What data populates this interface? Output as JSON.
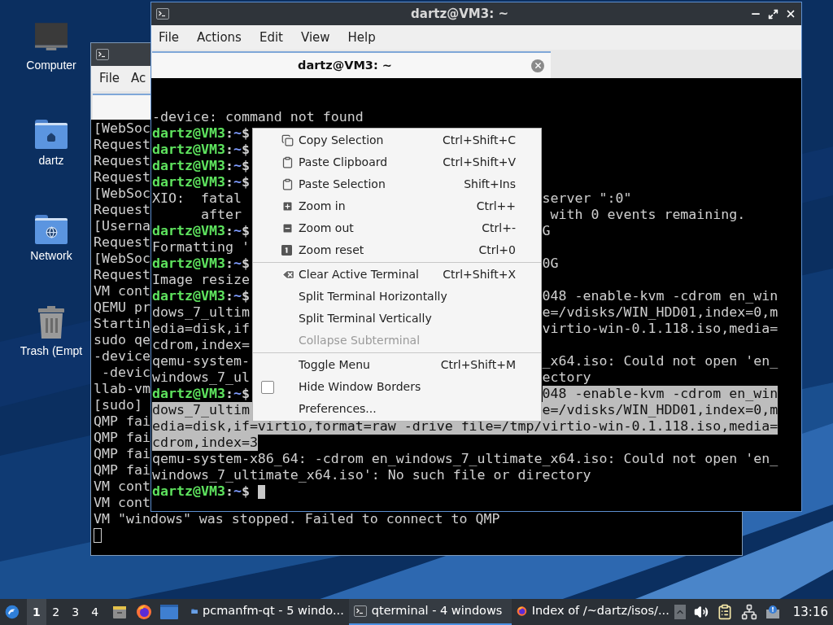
{
  "desktop": {
    "icons": [
      {
        "label": "Computer",
        "kind": "computer"
      },
      {
        "label": "dartz",
        "kind": "home"
      },
      {
        "label": "Network",
        "kind": "network"
      },
      {
        "label": "Trash (Empt",
        "kind": "trash"
      }
    ]
  },
  "back_window": {
    "menu": [
      "File",
      "Ac"
    ],
    "lines": [
      "[WebSoc",
      "Request",
      "Request",
      "Request",
      "[WebSoc",
      "Request",
      "[Userna",
      "Request",
      "[WebSoc",
      "Request",
      "VM cont",
      "QEMU pr",
      "Startin",
      "sudo qe",
      "-device",
      " -devic",
      "llab-vm",
      "[sudo] ",
      "QMP fai",
      "QMP fai",
      "QMP fai",
      "QMP fai",
      "VM cont",
      "VM cont",
      "VM \"windows\" was stopped. Failed to connect to QMP"
    ]
  },
  "front_window": {
    "title": "dartz@VM3: ~",
    "menu": [
      "File",
      "Actions",
      "Edit",
      "View",
      "Help"
    ],
    "tabs": [
      {
        "label": "dartz@VM3: ~",
        "selected": true
      }
    ],
    "lines": [
      {
        "text": "-device: command not found",
        "selected": false
      },
      {
        "prompt": {
          "user": "dartz@VM3",
          "colon": ":",
          "path": "~",
          "sign": "$"
        },
        "selected": false
      },
      {
        "prompt": {
          "user": "dartz@VM3",
          "colon": ":",
          "path": "~",
          "sign": "$"
        },
        "selected": false
      },
      {
        "prompt": {
          "user": "dartz@VM3",
          "colon": ":",
          "path": "~",
          "sign": "$"
        },
        "selected": false
      },
      {
        "prompt": {
          "user": "dartz@VM3",
          "colon": ":",
          "path": "~",
          "sign": "$"
        },
        "selected": false
      },
      {
        "text": "XIO:  fatal",
        "right": "server \":0\"",
        "selected": false
      },
      {
        "text": "      after",
        "right": " with 0 events remaining.",
        "selected": false
      },
      {
        "prompt": {
          "user": "dartz@VM3",
          "colon": ":",
          "path": "~",
          "sign": "$"
        },
        "right": "G",
        "selected": false
      },
      {
        "text": "Formatting '",
        "selected": false
      },
      {
        "prompt": {
          "user": "dartz@VM3",
          "colon": ":",
          "path": "~",
          "sign": "$"
        },
        "right": "0G",
        "selected": false
      },
      {
        "text": "Image resize",
        "selected": false
      },
      {
        "prompt": {
          "user": "dartz@VM3",
          "colon": ":",
          "path": "~",
          "sign": "$"
        },
        "right": "048 -enable-kvm -cdrom en_win",
        "selected": false
      },
      {
        "text": "dows_7_ultim",
        "right": "e=/vdisks/WIN_HDD01,index=0,m",
        "selected": false
      },
      {
        "text": "edia=disk,if",
        "right": "virtio-win-0.1.118.iso,media=",
        "selected": false
      },
      {
        "text": "cdrom,index=",
        "selected": false
      },
      {
        "text": "qemu-system-",
        "right": "_x64.iso: Could not open 'en_",
        "selected": false
      },
      {
        "text": "windows_7_ul",
        "right": "ectory",
        "selected": false
      },
      {
        "prompt": {
          "user": "dartz@VM3",
          "colon": ":",
          "path": "~",
          "sign": "$"
        },
        "right": "048 -enable-kvm -cdrom en_win",
        "selected": true
      },
      {
        "text": "dows_7_ultim",
        "right": "e=/vdisks/WIN_HDD01,index=0,m",
        "selected": true
      },
      {
        "text": "edia=disk,if=virtio,format=raw -drive file=/tmp/virtio-win-0.1.118.iso,media=",
        "selected": true
      },
      {
        "text": "cdrom,index=3",
        "selected": true
      },
      {
        "text": "qemu-system-x86_64: -cdrom en_windows_7_ultimate_x64.iso: Could not open 'en_",
        "selected": false
      },
      {
        "text": "windows_7_ultimate_x64.iso': No such file or directory",
        "selected": false
      },
      {
        "prompt": {
          "user": "dartz@VM3",
          "colon": ":",
          "path": "~",
          "sign": "$"
        },
        "cursor": true,
        "selected": false
      }
    ]
  },
  "context_menu": {
    "items": [
      {
        "kind": "copy",
        "label": "Copy Selection",
        "shortcut": "Ctrl+Shift+C",
        "disabled": false
      },
      {
        "kind": "paste",
        "label": "Paste Clipboard",
        "shortcut": "Ctrl+Shift+V",
        "disabled": false
      },
      {
        "kind": "paste",
        "label": "Paste Selection",
        "shortcut": "Shift+Ins",
        "disabled": false
      },
      {
        "kind": "zoomin",
        "label": "Zoom in",
        "shortcut": "Ctrl++",
        "disabled": false
      },
      {
        "kind": "zoomout",
        "label": "Zoom out",
        "shortcut": "Ctrl+-",
        "disabled": false
      },
      {
        "kind": "zoomreset",
        "label": "Zoom reset",
        "shortcut": "Ctrl+0",
        "disabled": false
      },
      {
        "kind": "separator"
      },
      {
        "kind": "clear",
        "label": "Clear Active Terminal",
        "shortcut": "Ctrl+Shift+X",
        "disabled": false
      },
      {
        "kind": "plain",
        "label": "Split Terminal Horizontally",
        "disabled": false
      },
      {
        "kind": "plain",
        "label": "Split Terminal Vertically",
        "disabled": false
      },
      {
        "kind": "plain",
        "label": "Collapse Subterminal",
        "disabled": true
      },
      {
        "kind": "separator"
      },
      {
        "kind": "plain",
        "label": "Toggle Menu",
        "shortcut": "Ctrl+Shift+M",
        "disabled": false
      },
      {
        "kind": "check",
        "label": "Hide Window Borders",
        "checked": false
      },
      {
        "kind": "plain",
        "label": "Preferences...",
        "disabled": false
      }
    ]
  },
  "taskbar": {
    "desktops": [
      {
        "label": "1",
        "selected": true
      },
      {
        "label": "2",
        "selected": false
      },
      {
        "label": "3",
        "selected": false
      },
      {
        "label": "4",
        "selected": false
      }
    ],
    "tasks": [
      {
        "label": "pcmanfm-qt - 5 windo...",
        "kind": "folder",
        "selected": false
      },
      {
        "label": "qterminal - 4 windows",
        "kind": "terminal",
        "selected": true
      },
      {
        "label": "Index of /~dartz/isos/...",
        "kind": "browser",
        "selected": false
      }
    ],
    "clock": "13:16"
  }
}
